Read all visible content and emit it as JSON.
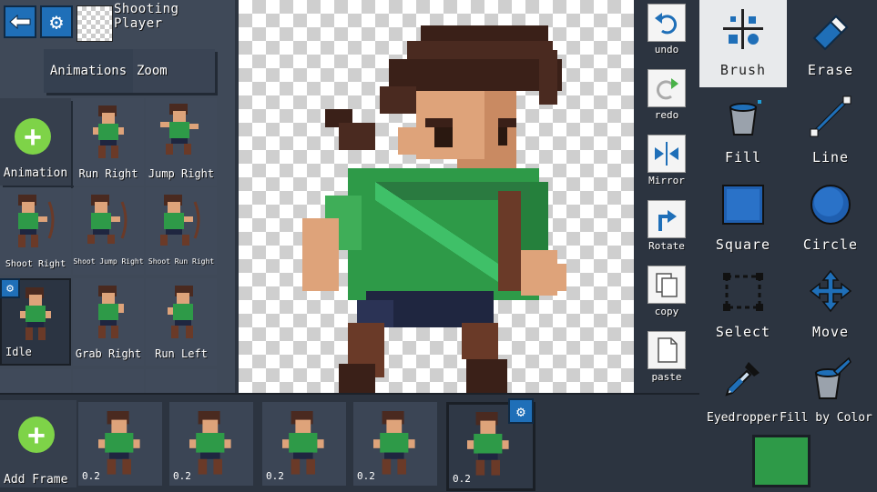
{
  "project": {
    "title": "Shooting Player"
  },
  "left_panel": {
    "tabs": {
      "animations": "Animations",
      "zoom": "Zoom"
    },
    "add_animation_label": "Animation",
    "animations": [
      {
        "label": "Run Right"
      },
      {
        "label": "Jump Right"
      },
      {
        "label": "Shoot Right"
      },
      {
        "label": "Shoot Jump Right"
      },
      {
        "label": "Shoot Run Right"
      },
      {
        "label": "Idle"
      },
      {
        "label": "Grab Right"
      },
      {
        "label": "Run Left"
      }
    ]
  },
  "mid_toolbar": {
    "undo": "undo",
    "redo": "redo",
    "mirror": "Mirror",
    "rotate": "Rotate",
    "copy": "copy",
    "paste": "paste"
  },
  "tools": {
    "brush": "Brush",
    "erase": "Erase",
    "fill": "Fill",
    "line": "Line",
    "square": "Square",
    "circle": "Circle",
    "select": "Select",
    "move": "Move",
    "eyedropper": "Eyedropper",
    "fill_by_color": "Fill by Color",
    "selected": "Brush",
    "current_color": "#2e9a48"
  },
  "frames": {
    "add_label": "Add Frame",
    "items": [
      {
        "duration": "0.2"
      },
      {
        "duration": "0.2"
      },
      {
        "duration": "0.2"
      },
      {
        "duration": "0.2"
      },
      {
        "duration": "0.2"
      }
    ],
    "selected_index": 4
  },
  "colors": {
    "accent_blue": "#1f6fb8",
    "add_green": "#7ed348",
    "shirt_green": "#2e9a48",
    "hair_brown": "#4a2a20",
    "skin": "#dea37a"
  }
}
